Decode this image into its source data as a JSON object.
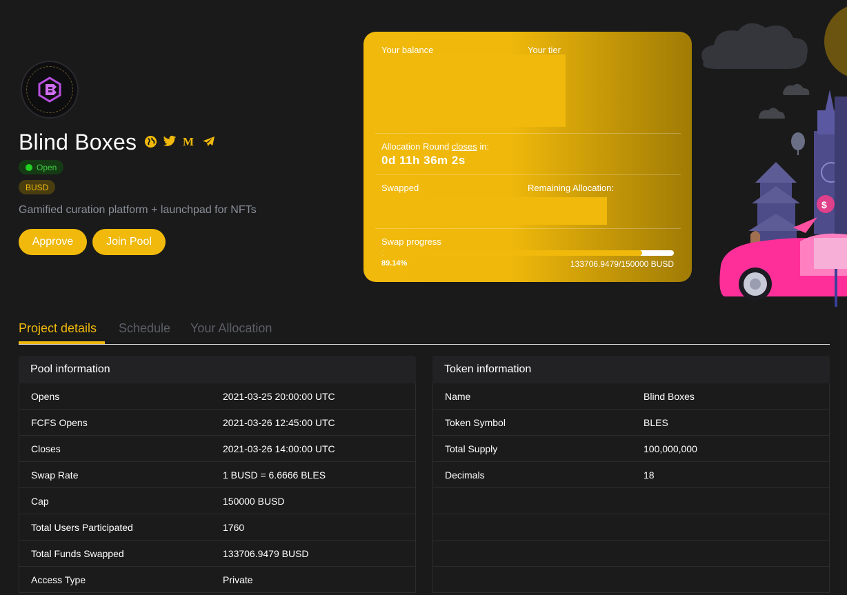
{
  "project": {
    "name": "Blind Boxes",
    "status": "Open",
    "currency": "BUSD",
    "tagline": "Gamified curation platform + launchpad for NFTs"
  },
  "actions": {
    "approve": "Approve",
    "join": "Join Pool"
  },
  "card": {
    "balance_label": "Your balance",
    "tier_label": "Your tier",
    "round_prefix": "Allocation Round ",
    "round_link": "closes",
    "round_suffix": " in:",
    "countdown": "0d 11h 36m 2s",
    "swapped_label": "Swapped",
    "remaining_label": "Remaining Allocation:",
    "progress_label": "Swap progress",
    "progress_percent_text": "89.14%",
    "progress_fraction": 0.8914,
    "progress_amounts": "133706.9479/150000 BUSD"
  },
  "tabs": [
    {
      "label": "Project details",
      "active": true
    },
    {
      "label": "Schedule",
      "active": false
    },
    {
      "label": "Your Allocation",
      "active": false
    }
  ],
  "pool_info": {
    "title": "Pool information",
    "rows": [
      {
        "key": "Opens",
        "value": "2021-03-25 20:00:00 UTC"
      },
      {
        "key": "FCFS Opens",
        "value": "2021-03-26 12:45:00 UTC"
      },
      {
        "key": "Closes",
        "value": "2021-03-26 14:00:00 UTC"
      },
      {
        "key": "Swap Rate",
        "value": "1 BUSD = 6.6666 BLES"
      },
      {
        "key": "Cap",
        "value": "150000 BUSD"
      },
      {
        "key": "Total Users Participated",
        "value": "1760"
      },
      {
        "key": "Total Funds Swapped",
        "value": "133706.9479 BUSD"
      },
      {
        "key": "Access Type",
        "value": "Private"
      }
    ]
  },
  "token_info": {
    "title": "Token information",
    "rows": [
      {
        "key": "Name",
        "value": "Blind Boxes"
      },
      {
        "key": "Token Symbol",
        "value": "BLES"
      },
      {
        "key": "Total Supply",
        "value": "100,000,000"
      },
      {
        "key": "Decimals",
        "value": "18"
      },
      {
        "key": "",
        "value": ""
      },
      {
        "key": "",
        "value": ""
      },
      {
        "key": "",
        "value": ""
      },
      {
        "key": "",
        "value": ""
      }
    ]
  },
  "icons": {
    "website": "globe-icon",
    "twitter": "twitter-icon",
    "medium": "medium-icon",
    "telegram": "telegram-icon"
  },
  "colors": {
    "accent": "#f0b90b",
    "open_green": "#22d022",
    "background": "#1a1a1a"
  }
}
